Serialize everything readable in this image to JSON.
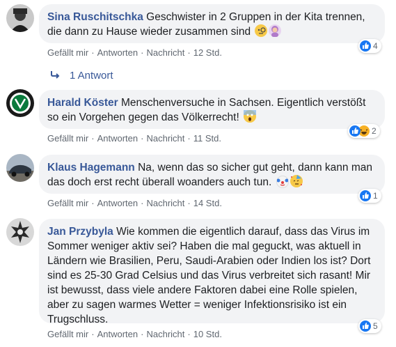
{
  "action_labels": {
    "like": "Gefällt mir",
    "reply": "Antworten",
    "message": "Nachricht",
    "separator": "·"
  },
  "comments": [
    {
      "author": "Sina Ruschitschka",
      "text": "Geschwister in 2 Gruppen in der Kita trennen, die dann zu Hause wieder zusammen sind",
      "emojis": [
        "monocle-face-emoji",
        "woman-facepalming-emoji"
      ],
      "time": "12 Std.",
      "reaction_count": "4",
      "reaction_types": [
        "like"
      ]
    },
    {
      "author": "Harald Köster",
      "text": "Menschenversuche in Sachsen. Eigentlich verstößt so ein Vorgehen gegen das Völkerrecht!",
      "emojis": [
        "screaming-face-emoji"
      ],
      "time": "11 Std.",
      "reaction_count": "2",
      "reaction_types": [
        "like",
        "haha"
      ]
    },
    {
      "author": "Klaus Hagemann",
      "text": "Na, wenn das so sicher gut geht, dann kann man das doch erst recht überall woanders auch tun.",
      "emojis": [
        "clown-face-emoji",
        "partying-face-emoji"
      ],
      "time": "14 Std.",
      "reaction_count": "1",
      "reaction_types": [
        "like"
      ]
    },
    {
      "author": "Jan Przybyla",
      "text": "Wie kommen die eigentlich darauf, dass das Virus im Sommer weniger aktiv sei? Haben die mal geguckt, was aktuell in Ländern wie Brasilien, Peru, Saudi-Arabien oder Indien los ist? Dort sind es 25-30 Grad Celsius und das Virus verbreitet sich rasant! Mir ist bewusst, dass viele andere Faktoren dabei eine Rolle spielen, aber zu sagen warmes Wetter = weniger Infektionsrisiko ist ein Trugschluss.",
      "emojis": [],
      "time": "10 Std.",
      "reaction_count": "5",
      "reaction_types": [
        "like"
      ]
    }
  ],
  "replies_link": "1 Antwort",
  "colors": {
    "author": "#385898",
    "bubble": "#f2f3f5",
    "meta": "#606770",
    "like": "#1877f2",
    "haha": "#f7b125"
  }
}
